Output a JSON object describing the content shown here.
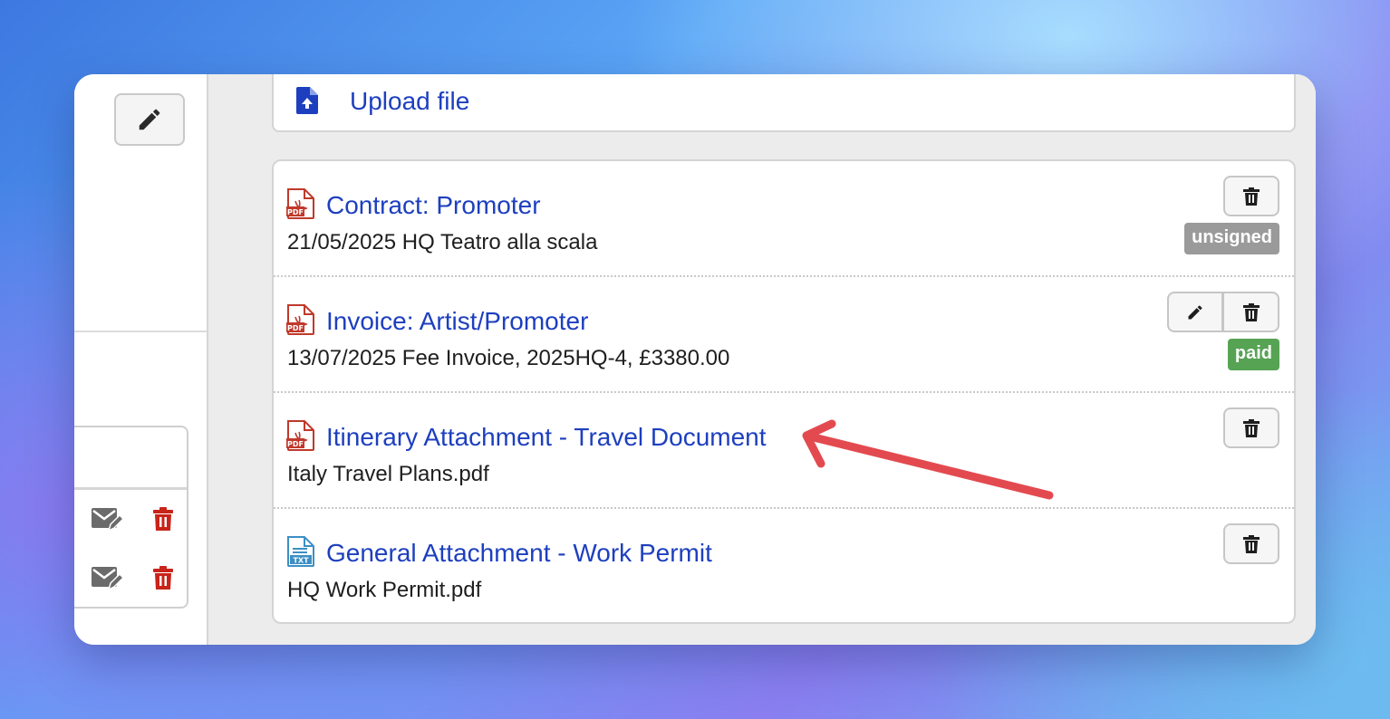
{
  "upload": {
    "label": "Upload file"
  },
  "files": [
    {
      "title": "Contract: Promoter",
      "subtitle": "21/05/2025 HQ Teatro alla scala",
      "type_icon": "pdf-icon",
      "actions": [
        "delete"
      ],
      "badge": {
        "text": "unsigned",
        "color": "#9a9a9a"
      }
    },
    {
      "title": "Invoice: Artist/Promoter",
      "subtitle": "13/07/2025 Fee Invoice, 2025HQ-4, £3380.00",
      "type_icon": "pdf-icon",
      "actions": [
        "edit",
        "delete"
      ],
      "badge": {
        "text": "paid",
        "color": "#56a353"
      }
    },
    {
      "title": "Itinerary Attachment - Travel Document",
      "subtitle": "Italy Travel Plans.pdf",
      "type_icon": "pdf-icon",
      "actions": [
        "delete"
      ]
    },
    {
      "title": "General Attachment - Work Permit",
      "subtitle": "HQ Work Permit.pdf",
      "type_icon": "txt-icon",
      "actions": [
        "delete"
      ]
    }
  ],
  "icons": {
    "pdf_label": "PDF",
    "txt_label": "TXT"
  },
  "colors": {
    "link": "#1d3fbf",
    "pdf": "#c0392b",
    "txt": "#3d8fc4",
    "delete_red": "#c8241a",
    "annotation_arrow": "#e34a4f"
  }
}
